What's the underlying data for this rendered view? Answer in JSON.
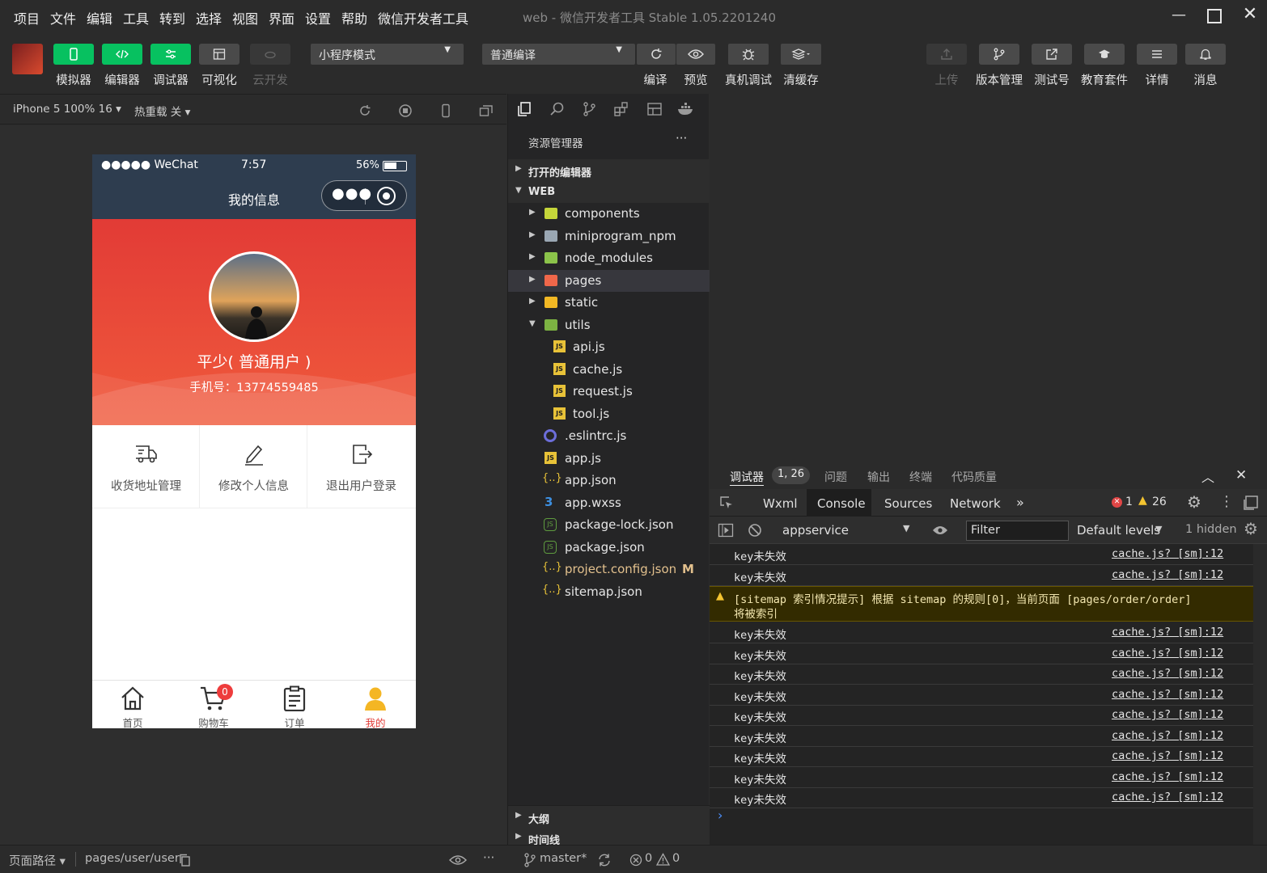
{
  "menubar": {
    "items": [
      "项目",
      "文件",
      "编辑",
      "工具",
      "转到",
      "选择",
      "视图",
      "界面",
      "设置",
      "帮助",
      "微信开发者工具"
    ],
    "title": "web  -  微信开发者工具 Stable 1.05.2201240"
  },
  "toolbar": {
    "simulator": "模拟器",
    "editor": "编辑器",
    "debugger": "调试器",
    "visual": "可视化",
    "cloud": "云开发",
    "mode_select": "小程序模式",
    "compile_select": "普通编译",
    "compile": "编译",
    "preview": "预览",
    "remote_debug": "真机调试",
    "clear_cache": "清缓存",
    "upload": "上传",
    "version": "版本管理",
    "test_id": "测试号",
    "edu": "教育套件",
    "details": "详情",
    "messages": "消息"
  },
  "simbar": {
    "device": "iPhone 5 100% 16",
    "hot_reload": "热重载 关"
  },
  "phone": {
    "carrier": "●●●●● WeChat",
    "time": "7:57",
    "battery": "56%",
    "nav_title": "我的信息",
    "user_name": "平少( 普通用户 )",
    "phone_number": "手机号：13774559485",
    "actions": [
      "收货地址管理",
      "修改个人信息",
      "退出用户登录"
    ],
    "tabs": [
      "首页",
      "购物车",
      "订单",
      "我的"
    ],
    "cart_badge": "0",
    "accent": "#e23b36"
  },
  "explorer": {
    "title": "资源管理器",
    "more": "···",
    "open_editors": "打开的编辑器",
    "root": "WEB",
    "folders": [
      "components",
      "miniprogram_npm",
      "node_modules",
      "pages",
      "static",
      "utils"
    ],
    "utils_files": [
      "api.js",
      "cache.js",
      "request.js",
      "tool.js"
    ],
    "root_files": [
      ".eslintrc.js",
      "app.js",
      "app.json",
      "app.wxss",
      "package-lock.json",
      "package.json",
      "project.config.json",
      "sitemap.json"
    ],
    "modified_mark": "M",
    "outline": "大纲",
    "timeline": "时间线"
  },
  "debugger": {
    "tabs": [
      "调试器",
      "问题",
      "输出",
      "终端",
      "代码质量"
    ],
    "badge": "1, 26",
    "inner_tabs": [
      "Wxml",
      "Console",
      "Sources",
      "Network"
    ],
    "more_tabs": "»",
    "errors": "1",
    "warnings": "26",
    "context": "appservice",
    "filter_placeholder": "Filter",
    "levels": "Default levels",
    "hidden": "1 hidden",
    "log_msg": "key未失效",
    "log_src": "cache.js? [sm]:12",
    "warn_msg_line1": "[sitemap 索引情况提示] 根据 sitemap 的规则[0]，当前页面 [pages/order/order]",
    "warn_msg_line2": "将被索引",
    "prompt": "›"
  },
  "statusbar": {
    "path_label": "页面路径",
    "path": "pages/user/user",
    "branch": "master*",
    "errors": "0",
    "warnings": "0"
  }
}
